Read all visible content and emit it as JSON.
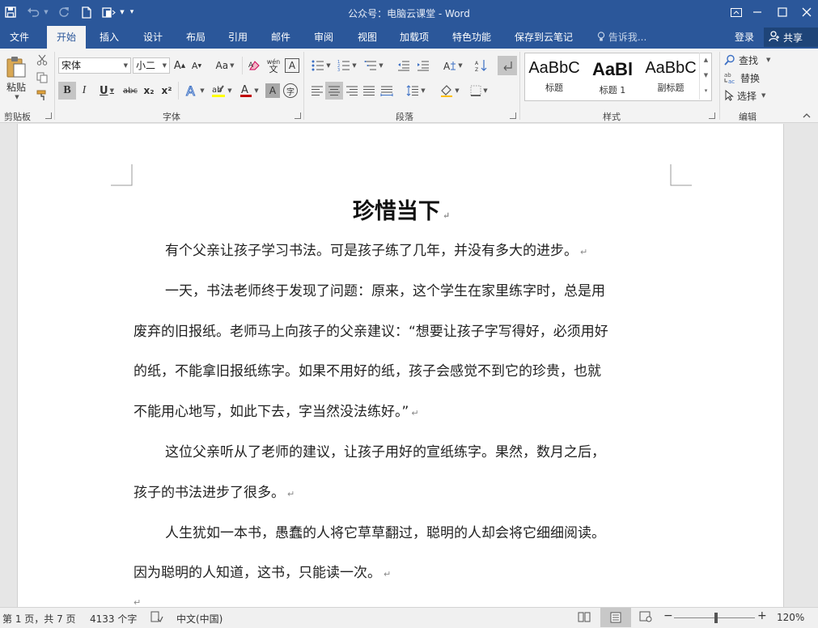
{
  "app": {
    "title": "公众号：电脑云课堂 - Word",
    "colors": {
      "accent": "#2b579a",
      "share_bg": "#1e4478",
      "ribbon_bg": "#f3f3f3"
    }
  },
  "quick_access": [
    {
      "name": "save-icon",
      "icon": "save"
    },
    {
      "name": "undo-icon",
      "icon": "undo"
    },
    {
      "name": "redo-icon",
      "icon": "redo"
    },
    {
      "name": "new-doc-icon",
      "icon": "new"
    },
    {
      "name": "touch-mode-icon",
      "icon": "touch"
    },
    {
      "name": "customize-qat-icon",
      "icon": "customize"
    }
  ],
  "window_controls": [
    "ribbon-display-options",
    "minimize",
    "maximize",
    "close"
  ],
  "tabs": {
    "items": [
      "文件",
      "开始",
      "插入",
      "设计",
      "布局",
      "引用",
      "邮件",
      "审阅",
      "视图",
      "加载项",
      "特色功能",
      "保存到云笔记"
    ],
    "active": "开始",
    "tell_me": "告诉我...",
    "login": "登录",
    "share": "共享"
  },
  "ribbon": {
    "clipboard": {
      "label": "剪贴板",
      "paste": "粘贴"
    },
    "font": {
      "label": "字体",
      "font_name": "宋体",
      "font_size": "小二",
      "change_case": "Aa",
      "phonetic": "wén",
      "bold": "B",
      "italic": "I",
      "underline": "U",
      "strikethrough": "abc",
      "subscript": "x₂",
      "superscript": "x²",
      "clear_format": "A",
      "char_border": "A",
      "enclose": "字"
    },
    "paragraph": {
      "label": "段落"
    },
    "styles": {
      "label": "样式",
      "items": [
        {
          "sample": "AaBbC",
          "name": "标题"
        },
        {
          "sample": "AaBl",
          "name": "标题 1"
        },
        {
          "sample": "AaBbC",
          "name": "副标题"
        }
      ]
    },
    "editing": {
      "label": "编辑",
      "find": "查找",
      "replace": "替换",
      "select": "选择"
    }
  },
  "document": {
    "title": "珍惜当下",
    "paragraph_mark": "↵",
    "lines": [
      "有个父亲让孩子学习书法。可是孩子练了几年，并没有多大的进步。",
      "一天，书法老师终于发现了问题：原来，这个学生在家里练字时，总是用",
      "废弃的旧报纸。老师马上向孩子的父亲建议：“想要让孩子字写得好，必须用好",
      "的纸，不能拿旧报纸练字。如果不用好的纸，孩子会感觉不到它的珍贵，也就",
      "不能用心地写，如此下去，字当然没法练好。”",
      "这位父亲听从了老师的建议，让孩子用好的宣纸练字。果然，数月之后，",
      "孩子的书法进步了很多。",
      "人生犹如一本书，愚蠢的人将它草草翻过，聪明的人却会将它细细阅读。",
      "因为聪明的人知道，这书，只能读一次。"
    ]
  },
  "status": {
    "page": "第 1 页，共 7 页",
    "words": "4133 个字",
    "language": "中文(中国)",
    "zoom": "120%",
    "zoom_minus": "−",
    "zoom_plus": "+"
  }
}
